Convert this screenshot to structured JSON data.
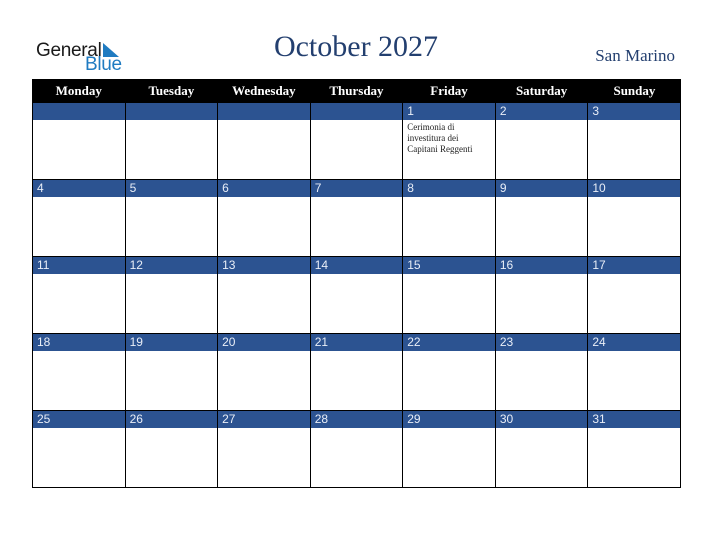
{
  "logo": {
    "general": "General",
    "blue": "Blue",
    "icon": "triangle-flag-icon"
  },
  "title": "October 2027",
  "region": "San Marino",
  "weekdays": [
    "Monday",
    "Tuesday",
    "Wednesday",
    "Thursday",
    "Friday",
    "Saturday",
    "Sunday"
  ],
  "weeks": [
    [
      {
        "day": "",
        "event": ""
      },
      {
        "day": "",
        "event": ""
      },
      {
        "day": "",
        "event": ""
      },
      {
        "day": "",
        "event": ""
      },
      {
        "day": "1",
        "event": "Cerimonia di investitura dei Capitani Reggenti"
      },
      {
        "day": "2",
        "event": ""
      },
      {
        "day": "3",
        "event": ""
      }
    ],
    [
      {
        "day": "4",
        "event": ""
      },
      {
        "day": "5",
        "event": ""
      },
      {
        "day": "6",
        "event": ""
      },
      {
        "day": "7",
        "event": ""
      },
      {
        "day": "8",
        "event": ""
      },
      {
        "day": "9",
        "event": ""
      },
      {
        "day": "10",
        "event": ""
      }
    ],
    [
      {
        "day": "11",
        "event": ""
      },
      {
        "day": "12",
        "event": ""
      },
      {
        "day": "13",
        "event": ""
      },
      {
        "day": "14",
        "event": ""
      },
      {
        "day": "15",
        "event": ""
      },
      {
        "day": "16",
        "event": ""
      },
      {
        "day": "17",
        "event": ""
      }
    ],
    [
      {
        "day": "18",
        "event": ""
      },
      {
        "day": "19",
        "event": ""
      },
      {
        "day": "20",
        "event": ""
      },
      {
        "day": "21",
        "event": ""
      },
      {
        "day": "22",
        "event": ""
      },
      {
        "day": "23",
        "event": ""
      },
      {
        "day": "24",
        "event": ""
      }
    ],
    [
      {
        "day": "25",
        "event": ""
      },
      {
        "day": "26",
        "event": ""
      },
      {
        "day": "27",
        "event": ""
      },
      {
        "day": "28",
        "event": ""
      },
      {
        "day": "29",
        "event": ""
      },
      {
        "day": "30",
        "event": ""
      },
      {
        "day": "31",
        "event": ""
      }
    ]
  ],
  "colors": {
    "title": "#233f6f",
    "datebar": "#2c5391",
    "header": "#000000",
    "logo_blue": "#1f7bc1"
  }
}
